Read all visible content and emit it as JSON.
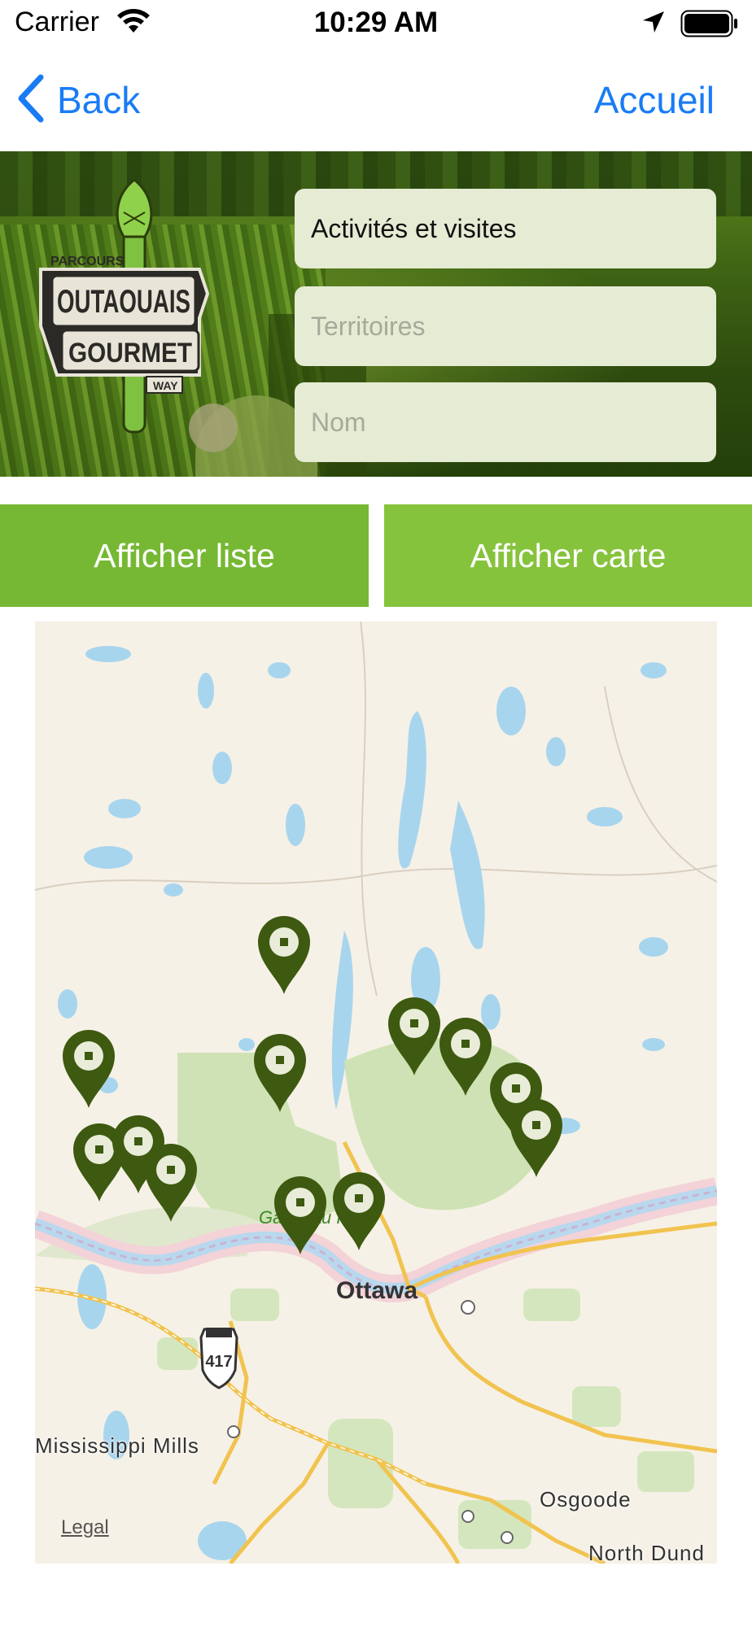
{
  "status_bar": {
    "carrier": "Carrier",
    "time": "10:29 AM"
  },
  "nav": {
    "back_label": "Back",
    "home_label": "Accueil"
  },
  "logo": {
    "line1": "PARCOURS",
    "line2": "OUTAOUAIS",
    "line3": "GOURMET",
    "line4": "WAY"
  },
  "filters": {
    "category_value": "Activités et visites",
    "territory_placeholder": "Territoires",
    "name_placeholder": "Nom"
  },
  "view_toggle": {
    "list_label": "Afficher liste",
    "map_label": "Afficher carte"
  },
  "map": {
    "park_label": "Gatineau Park",
    "city_label": "Ottawa",
    "highway_number": "417",
    "places": [
      "Mississippi Mills",
      "Osgoode",
      "North Dund"
    ],
    "legal_label": "Legal",
    "pin_count": 13
  },
  "colors": {
    "accent_blue": "#1a7cf5",
    "button_green": "#76b833",
    "button_green_alt": "#86c33c",
    "pin_green": "#3d5a10",
    "field_bg": "#e6ebd4"
  }
}
